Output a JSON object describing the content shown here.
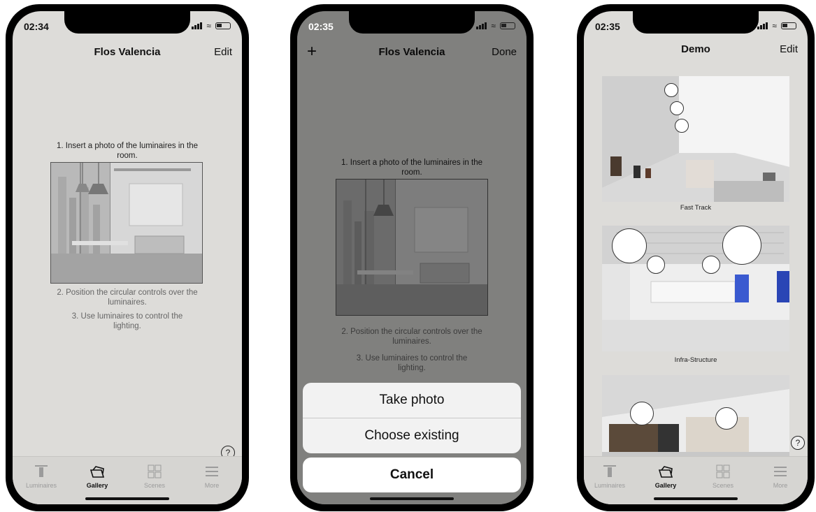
{
  "phone1": {
    "status_time": "02:34",
    "nav": {
      "title": "Flos Valencia",
      "right": "Edit"
    },
    "instructions": {
      "step1": "1. Insert a photo of the luminaires in the room.",
      "step2": "2. Position the circular controls over the luminaires.",
      "step3": "3. Use luminaires to control the lighting."
    },
    "help": "?",
    "tabs": [
      {
        "label": "Luminaires",
        "icon": "luminaire-icon",
        "active": false
      },
      {
        "label": "Gallery",
        "icon": "gallery-icon",
        "active": true
      },
      {
        "label": "Scenes",
        "icon": "scenes-grid-icon",
        "active": false
      },
      {
        "label": "More",
        "icon": "menu-icon",
        "active": false
      }
    ]
  },
  "phone2": {
    "status_time": "02:35",
    "nav": {
      "left": "+",
      "title": "Flos Valencia",
      "right": "Done"
    },
    "instructions": {
      "step1": "1. Insert a photo of the luminaires in the room.",
      "step2": "2. Position the circular controls over the luminaires.",
      "step3": "3. Use luminaires to control the lighting."
    },
    "action_sheet": {
      "options": [
        "Take photo",
        "Choose existing"
      ],
      "cancel": "Cancel"
    }
  },
  "phone3": {
    "status_time": "02:35",
    "nav": {
      "title": "Demo",
      "right": "Edit"
    },
    "gallery": [
      {
        "caption": "Fast Track"
      },
      {
        "caption": "Infra-Structure"
      },
      {
        "caption": ""
      }
    ],
    "help": "?",
    "tabs": [
      {
        "label": "Luminaires",
        "icon": "luminaire-icon",
        "active": false
      },
      {
        "label": "Gallery",
        "icon": "gallery-icon",
        "active": true
      },
      {
        "label": "Scenes",
        "icon": "scenes-grid-icon",
        "active": false
      },
      {
        "label": "More",
        "icon": "menu-icon",
        "active": false
      }
    ]
  }
}
